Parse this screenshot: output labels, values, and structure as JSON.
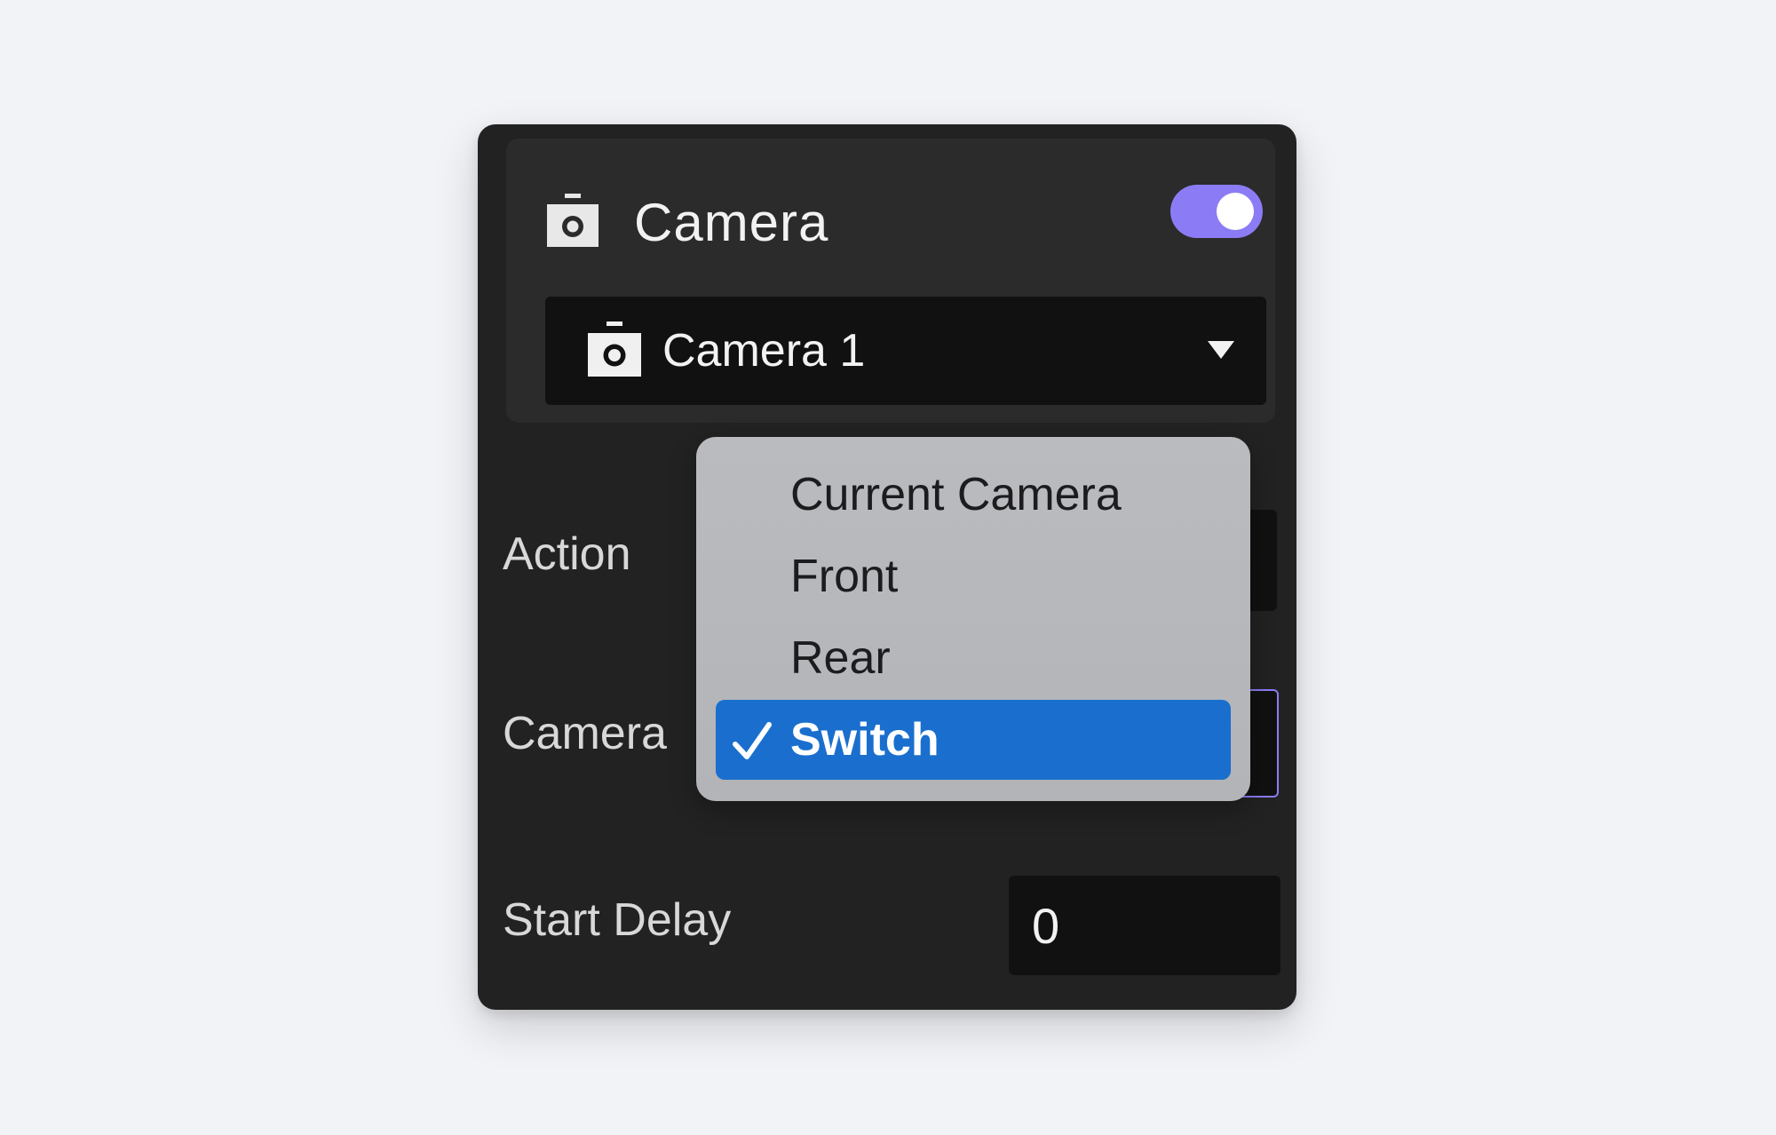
{
  "header": {
    "title": "Camera",
    "icon": "camera-icon",
    "toggle_on": true,
    "accent_color": "#8b7cf6"
  },
  "camera_select": {
    "value": "Camera 1",
    "icon": "camera-icon"
  },
  "rows": {
    "action_label": "Action",
    "camera_label": "Camera",
    "start_delay_label": "Start Delay",
    "start_delay_value": "0"
  },
  "dropdown": {
    "items": [
      {
        "label": "Current Camera",
        "selected": false
      },
      {
        "label": "Front",
        "selected": false
      },
      {
        "label": "Rear",
        "selected": false
      },
      {
        "label": "Switch",
        "selected": true
      }
    ],
    "selected_color": "#1a6fce"
  }
}
